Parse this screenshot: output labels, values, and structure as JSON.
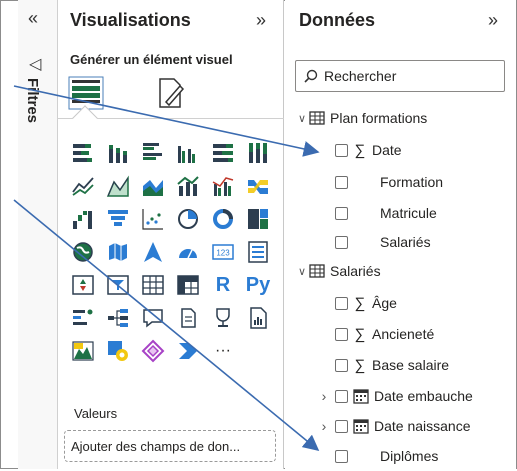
{
  "filters": {
    "collapse_icon": "«",
    "label": "Filtres"
  },
  "visualisations": {
    "title": "Visualisations",
    "expand_icon": "»",
    "subtitle": "Générer un élément visuel",
    "icons": [
      "stacked-bar-chart-icon",
      "stacked-column-chart-icon",
      "clustered-bar-chart-icon",
      "clustered-column-chart-icon",
      "100-stacked-bar-chart-icon",
      "100-stacked-column-chart-icon",
      "line-chart-icon",
      "area-chart-icon",
      "stacked-area-chart-icon",
      "line-and-stacked-column-icon",
      "line-and-clustered-column-icon",
      "ribbon-chart-icon",
      "waterfall-chart-icon",
      "funnel-chart-icon",
      "scatter-chart-icon",
      "pie-chart-icon",
      "donut-chart-icon",
      "treemap-icon",
      "map-icon",
      "filled-map-icon",
      "azure-map-icon",
      "gauge-icon",
      "card-icon",
      "multi-row-card-icon",
      "kpi-icon",
      "slicer-icon",
      "table-icon",
      "matrix-icon",
      "r-script-visual-icon",
      "python-visual-icon",
      "key-influencers-icon",
      "decomposition-tree-icon",
      "qa-icon",
      "smart-narrative-icon",
      "goals-icon",
      "paginated-report-icon",
      "arcgis-map-icon",
      "power-apps-icon",
      "power-automate-icon",
      "more-visuals-icon"
    ],
    "r_label": "R",
    "py_label": "Py",
    "card_label": "123",
    "more_label": "···",
    "valeurs_label": "Valeurs",
    "add_field_placeholder": "Ajouter des champs de don..."
  },
  "data": {
    "title": "Données",
    "expand_icon": "»",
    "search_placeholder": "Rechercher",
    "tables": [
      {
        "name": "Plan formations",
        "fields": [
          {
            "name": "Date",
            "type": "sigma"
          },
          {
            "name": "Formation",
            "type": "text"
          },
          {
            "name": "Matricule",
            "type": "text"
          },
          {
            "name": "Salariés",
            "type": "text"
          }
        ]
      },
      {
        "name": "Salariés",
        "fields": [
          {
            "name": "Âge",
            "type": "sigma"
          },
          {
            "name": "Ancieneté",
            "type": "sigma"
          },
          {
            "name": "Base salaire",
            "type": "sigma"
          },
          {
            "name": "Date embauche",
            "type": "date"
          },
          {
            "name": "Date naissance",
            "type": "date"
          },
          {
            "name": "Diplômes",
            "type": "text"
          }
        ]
      }
    ]
  },
  "colors": {
    "arrow": "#3b6bb0",
    "accent_green": "#1e7145",
    "accent_blue": "#2b7cd3"
  }
}
